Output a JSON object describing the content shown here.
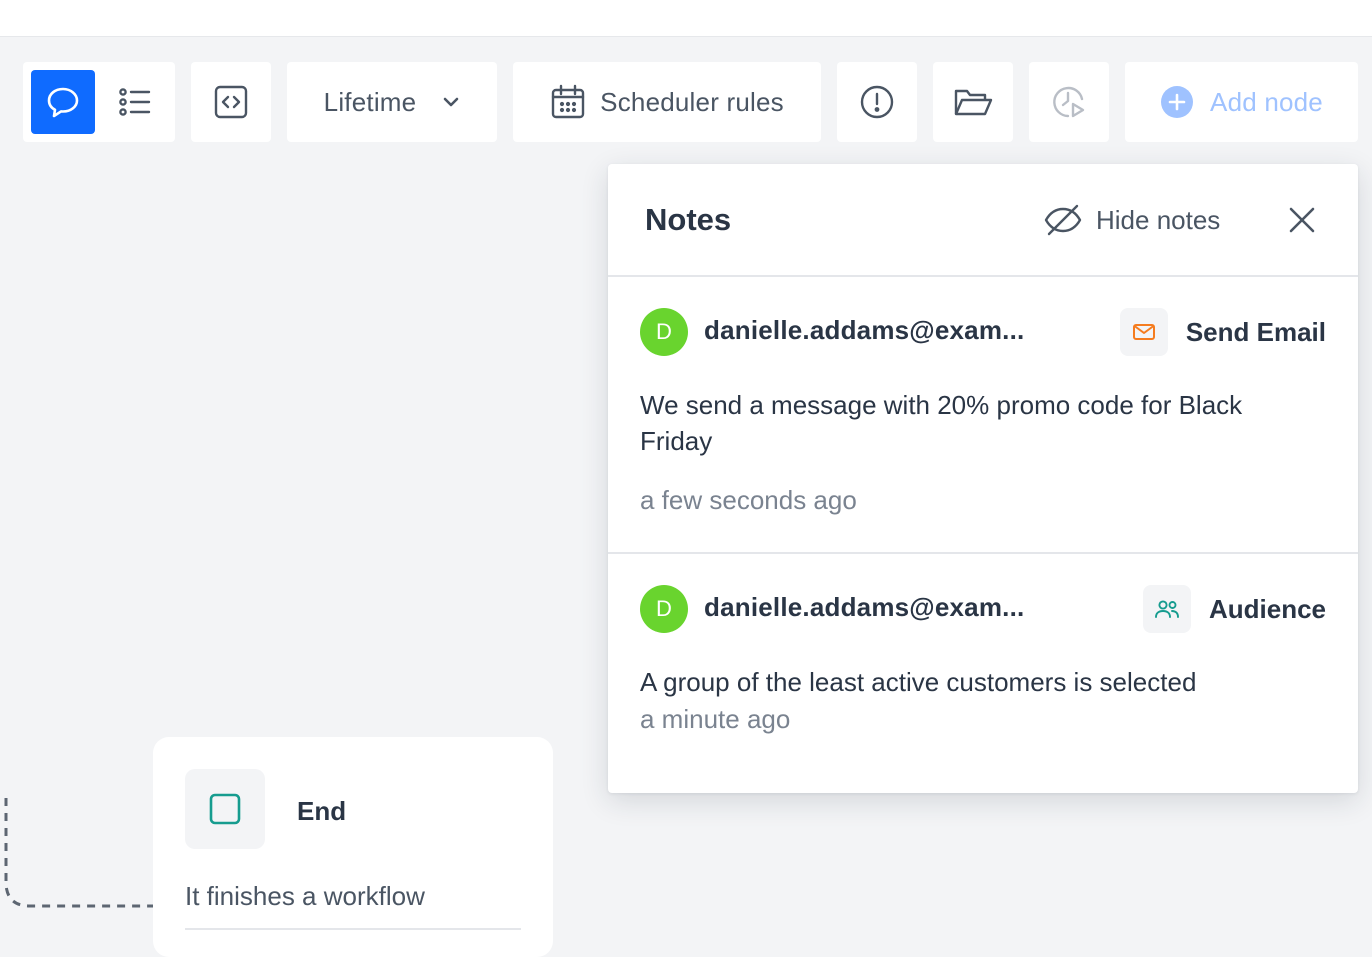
{
  "toolbar": {
    "lifetime_label": "Lifetime",
    "scheduler_label": "Scheduler rules",
    "add_node_label": "Add node"
  },
  "notes_panel": {
    "title": "Notes",
    "hide_label": "Hide notes",
    "notes": [
      {
        "avatar_letter": "D",
        "author": "danielle.addams@exam...",
        "node_label": "Send Email",
        "node_icon": "envelope-icon",
        "text": "We send a message with 20% promo code for Black Friday",
        "time": "a few seconds ago"
      },
      {
        "avatar_letter": "D",
        "author": "danielle.addams@exam...",
        "node_label": "Audience",
        "node_icon": "users-icon",
        "text": "A group of the least active customers is selected",
        "time": "a minute ago"
      }
    ]
  },
  "end_node": {
    "title": "End",
    "description": "It finishes a workflow"
  },
  "colors": {
    "accent": "#0f6bff",
    "avatar": "#69d42e",
    "email_icon": "#f57c1f",
    "audience_icon": "#169c8f",
    "end_icon": "#169c8f",
    "disabled": "#9fc2ff"
  }
}
